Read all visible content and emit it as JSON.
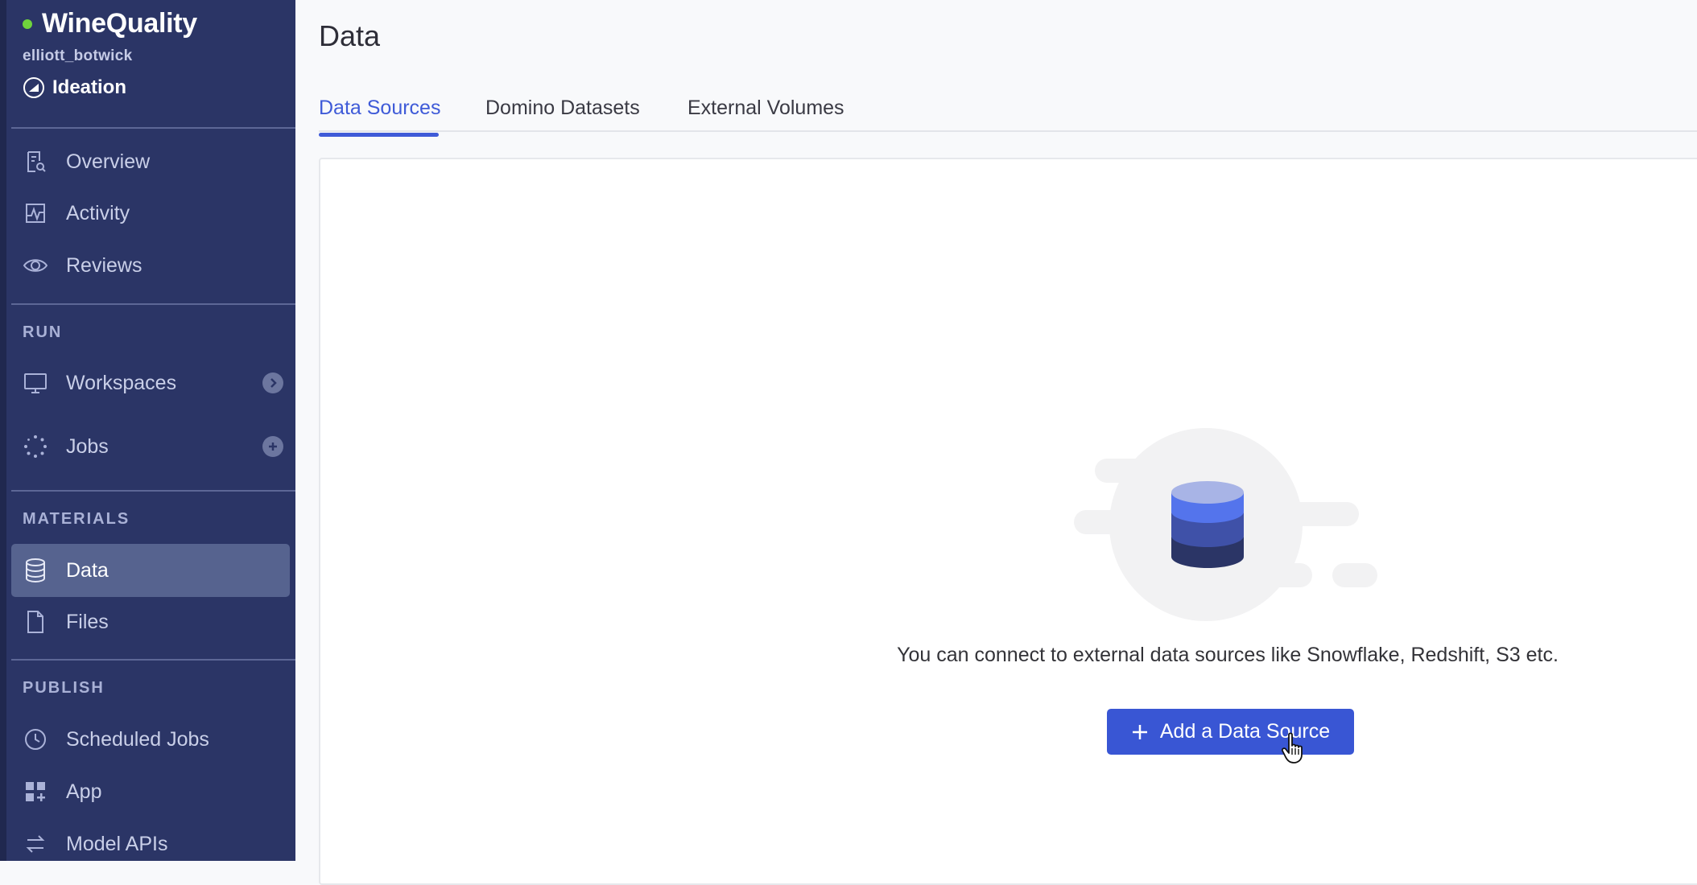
{
  "sidebar": {
    "project_name": "WineQuality",
    "owner": "elliott_botwick",
    "stage": "Ideation",
    "top_items": [
      {
        "label": "Overview",
        "icon": "overview-icon"
      },
      {
        "label": "Activity",
        "icon": "activity-icon"
      },
      {
        "label": "Reviews",
        "icon": "eye-icon"
      }
    ],
    "sections": {
      "run": {
        "label": "RUN",
        "items": [
          {
            "label": "Workspaces",
            "icon": "monitor-icon",
            "action_icon": "chevron-right-icon"
          },
          {
            "label": "Jobs",
            "icon": "jobs-spinner-icon",
            "action_icon": "plus-icon"
          }
        ]
      },
      "materials": {
        "label": "MATERIALS",
        "items": [
          {
            "label": "Data",
            "icon": "database-icon",
            "active": true
          },
          {
            "label": "Files",
            "icon": "file-icon"
          }
        ]
      },
      "publish": {
        "label": "PUBLISH",
        "items": [
          {
            "label": "Scheduled Jobs",
            "icon": "clock-icon"
          },
          {
            "label": "App",
            "icon": "app-grid-icon"
          },
          {
            "label": "Model APIs",
            "icon": "arrows-exchange-icon"
          }
        ]
      }
    }
  },
  "main": {
    "title": "Data",
    "tabs": [
      {
        "label": "Data Sources",
        "active": true
      },
      {
        "label": "Domino Datasets"
      },
      {
        "label": "External Volumes"
      }
    ],
    "empty_state": {
      "message": "You can connect to external data sources like Snowflake, Redshift, S3 etc.",
      "button_label": "Add a Data Source",
      "illustration": "database-stack-illustration"
    }
  },
  "colors": {
    "sidebar_bg": "#2b3566",
    "sidebar_active": "#56638f",
    "accent": "#3f5bd8",
    "button": "#3956d4",
    "status_dot": "#6fd43c"
  }
}
